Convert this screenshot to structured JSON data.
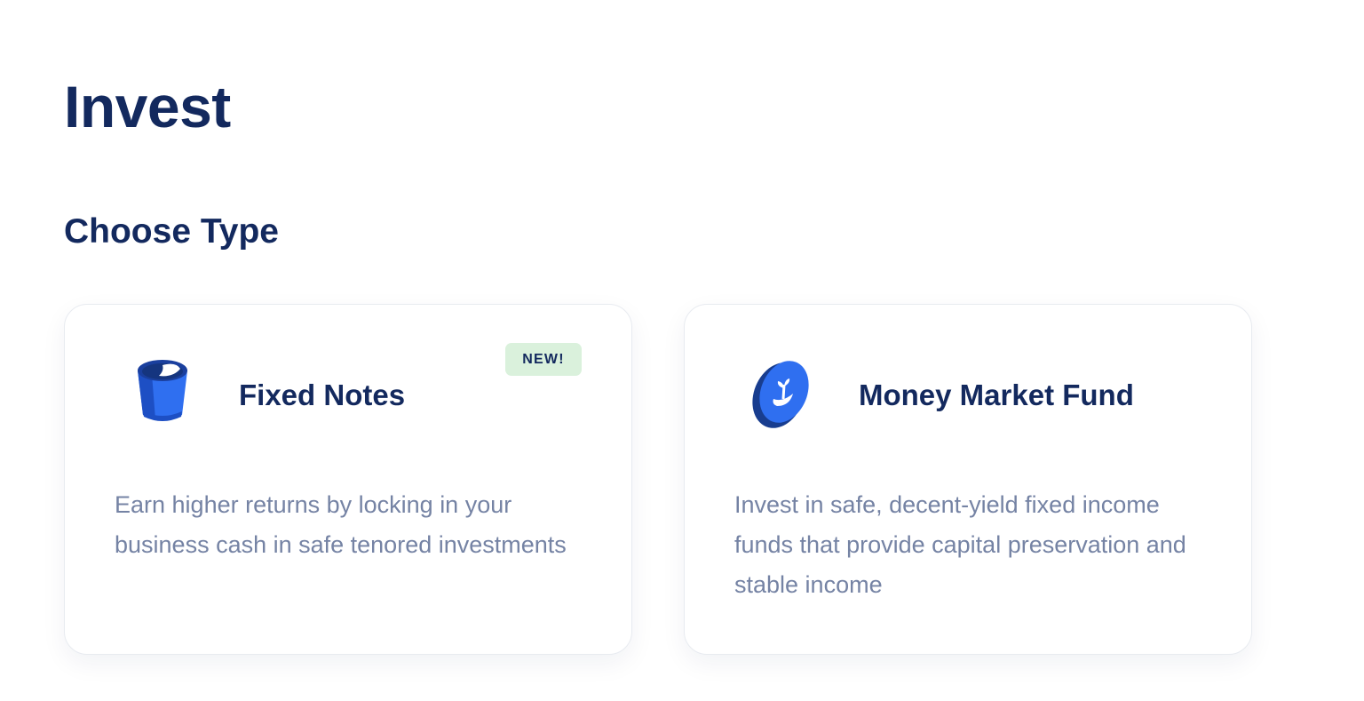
{
  "page": {
    "title": "Invest",
    "section_title": "Choose Type"
  },
  "cards": [
    {
      "title": "Fixed Notes",
      "badge": "NEW!",
      "icon": "bucket-icon",
      "description": "Earn higher returns by locking in your business cash in safe tenored investments"
    },
    {
      "title": "Money Market Fund",
      "icon": "plant-coin-icon",
      "description": "Invest in safe, decent-yield fixed income funds that provide capital preservation and stable income"
    }
  ],
  "colors": {
    "heading": "#13295e",
    "body_text": "#7583a4",
    "accent_blue": "#2563eb",
    "badge_bg": "#daf1dc"
  }
}
